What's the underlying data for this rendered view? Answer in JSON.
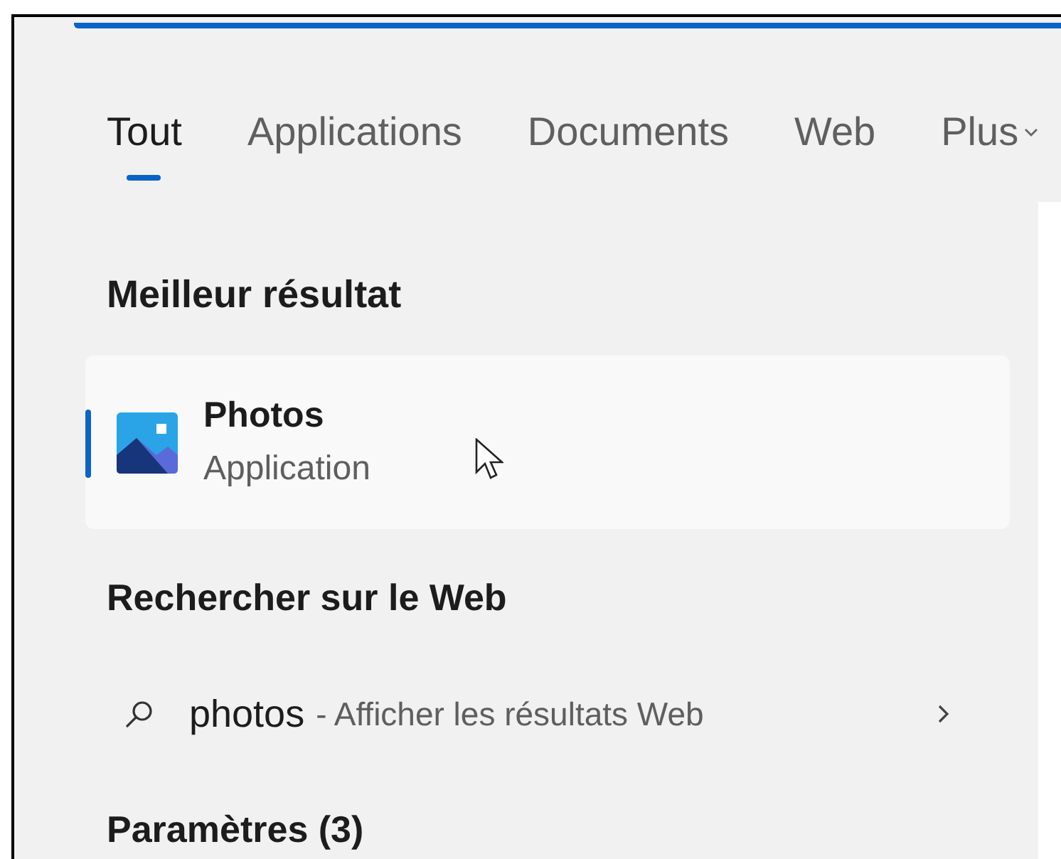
{
  "tabs": [
    {
      "label": "Tout",
      "selected": true
    },
    {
      "label": "Applications",
      "selected": false
    },
    {
      "label": "Documents",
      "selected": false
    },
    {
      "label": "Web",
      "selected": false
    },
    {
      "label": "Plus",
      "selected": false
    }
  ],
  "best_result": {
    "heading": "Meilleur résultat",
    "title": "Photos",
    "subtitle": "Application",
    "selected": true
  },
  "web_search": {
    "heading": "Rechercher sur le Web",
    "query": "photos",
    "suffix": "- Afficher les résultats Web"
  },
  "settings": {
    "heading": "Paramètres (3)"
  }
}
